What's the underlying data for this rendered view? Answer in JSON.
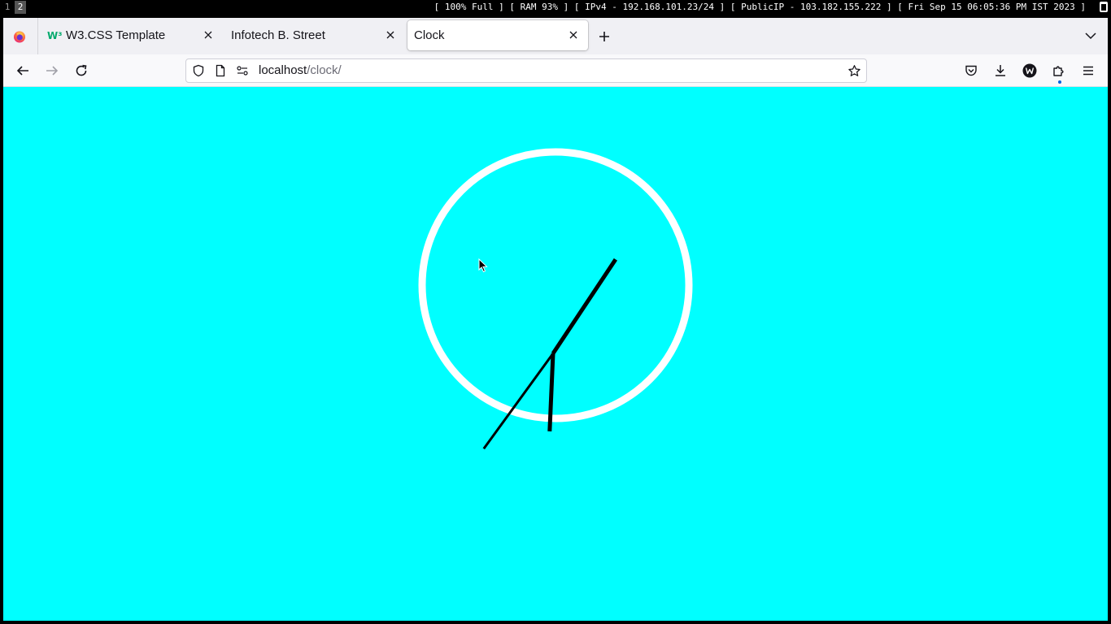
{
  "desktop": {
    "workspaces": [
      "1",
      "2"
    ],
    "active_workspace": "2",
    "status_text": "[ 100% Full ] [ RAM 93% ] [ IPv4 - 192.168.101.23/24 ] [ PublicIP - 103.182.155.222 ] [ Fri Sep 15 06:05:36 PM IST 2023 ]"
  },
  "browser": {
    "tabs": [
      {
        "favicon_text": "W³",
        "title": "W3.CSS Template",
        "active": false
      },
      {
        "title": "Infotech B. Street",
        "active": false
      },
      {
        "title": "Clock",
        "active": true
      }
    ],
    "url": {
      "host": "localhost",
      "path": "/clock/"
    }
  },
  "page": {
    "background": "#00ffff",
    "clock": {
      "face_color": "#ffffff",
      "hand_color": "#000000",
      "hours": 6,
      "minutes": 5,
      "seconds": 36
    }
  },
  "colors": {
    "accent": "#0061e0",
    "w3_green": "#04aa6d"
  }
}
